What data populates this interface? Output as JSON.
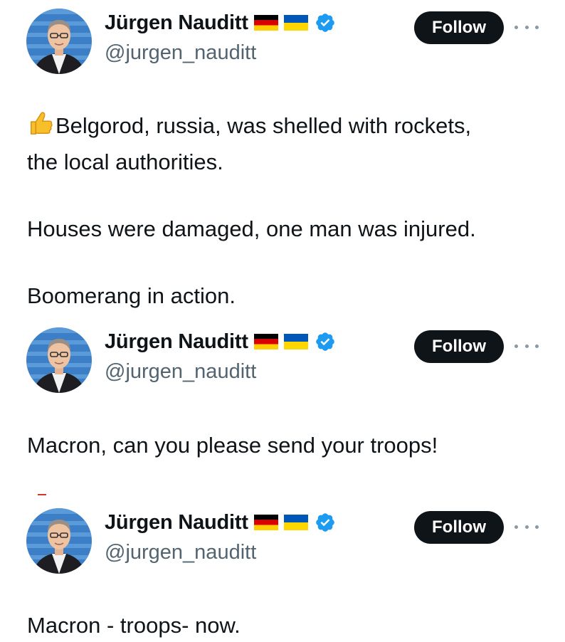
{
  "posts": [
    {
      "author": {
        "name": "Jürgen Nauditt",
        "handle": "@jurgen_nauditt",
        "verified": true
      },
      "flags": [
        "germany-flag",
        "ukraine-flag"
      ],
      "follow_label": "Follow",
      "emoji": "thumbs-up-emoji",
      "text": [
        "Belgorod, russia, was shelled with rockets,",
        "the local authorities.",
        "Houses were damaged, one man was injured.",
        "Boomerang in action."
      ]
    },
    {
      "author": {
        "name": "Jürgen Nauditt",
        "handle": "@jurgen_nauditt",
        "verified": true
      },
      "flags": [
        "germany-flag",
        "ukraine-flag"
      ],
      "follow_label": "Follow",
      "text": [
        "Macron, can you please send your troops!"
      ]
    },
    {
      "author": {
        "name": "Jürgen Nauditt",
        "handle": "@jurgen_nauditt",
        "verified": true
      },
      "flags": [
        "germany-flag",
        "ukraine-flag"
      ],
      "follow_label": "Follow",
      "text": [
        "Macron - troops- now."
      ]
    }
  ],
  "colors": {
    "text": "#0f1419",
    "handle": "#536471",
    "follow_bg": "#0f1419",
    "verified": "#1d9bf0"
  }
}
